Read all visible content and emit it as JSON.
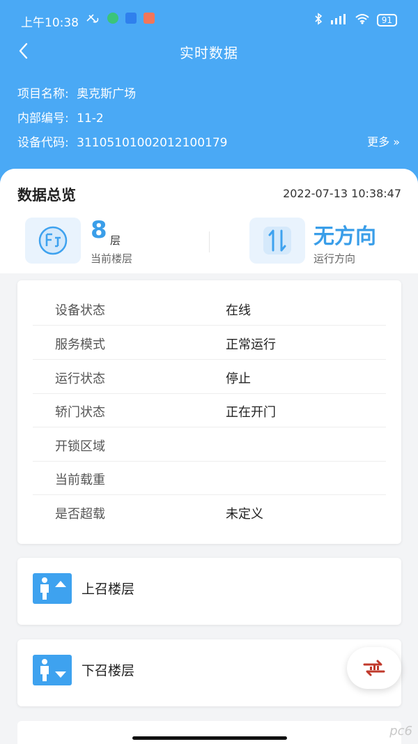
{
  "status_bar": {
    "time": "上午10:38",
    "battery": "91"
  },
  "header": {
    "title": "实时数据",
    "project_label": "项目名称:",
    "project_value": "奥克斯广场",
    "internal_label": "内部编号:",
    "internal_value": "11-2",
    "device_label": "设备代码:",
    "device_value": "31105101002012100179",
    "more": "更多 »"
  },
  "overview": {
    "title": "数据总览",
    "timestamp": "2022-07-13 10:38:47",
    "floor_value": "8",
    "floor_unit": "层",
    "floor_label": "当前楼层",
    "direction_value": "无方向",
    "direction_label": "运行方向"
  },
  "details": [
    {
      "key": "设备状态",
      "value": "在线"
    },
    {
      "key": "服务模式",
      "value": "正常运行"
    },
    {
      "key": "运行状态",
      "value": "停止"
    },
    {
      "key": "轿门状态",
      "value": "正在开门"
    },
    {
      "key": "开锁区域",
      "value": ""
    },
    {
      "key": "当前载重",
      "value": ""
    },
    {
      "key": "是否超载",
      "value": "未定义"
    }
  ],
  "calls": {
    "up_label": "上召楼层",
    "down_label": "下召楼层"
  },
  "watermark": "pc6",
  "colors": {
    "header_bg": "#4aa9f5",
    "accent": "#3a9ee9",
    "fab_icon": "#c0392b"
  }
}
